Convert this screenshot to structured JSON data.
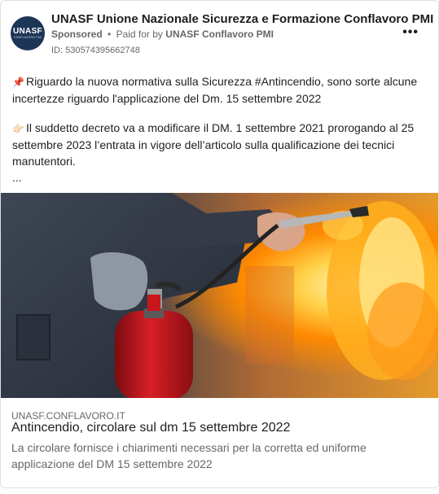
{
  "post": {
    "page_name": "UNASF Unione Nazionale Sicurezza e Formazione Conflavoro PMI",
    "sponsored_label": "Sponsored",
    "dot": "•",
    "paid_for_prefix": "Paid for by",
    "paid_for_by": "UNASF Conflavoro PMI",
    "ad_id": "ID: 530574395662748",
    "more_label": "•••",
    "avatar": {
      "logo_text": "UNASF",
      "logo_sub": "CONFLAVORO PMI"
    },
    "body": {
      "p1_emoji": "📌",
      "p1": "Riguardo la nuova normativa sulla Sicurezza #Antincendio, sono sorte alcune incertezze riguardo l'applicazione del Dm. 15 settembre 2022",
      "p2_emoji": "👉🏻",
      "p2": "Il suddetto decreto va a modificare il DM. 1 settembre 2021 prorogando al 25 settembre 2023 l’entrata in vigore dell’articolo sulla qualificazione dei tecnici manutentori.",
      "ellipsis": "..."
    },
    "link": {
      "domain": "UNASF.CONFLAVORO.IT",
      "title": "Antincendio, circolare sul dm 15 settembre 2022",
      "description": "La circolare fornisce i chiarimenti necessari per la corretta ed uniforme applicazione del DM 15 settembre 2022"
    },
    "colors": {
      "accent_text": "#1c1e21",
      "secondary_text": "#65676b",
      "avatar_bg": "#1d3557",
      "extinguisher_red": "#c8161d",
      "fire_orange": "#ff8a00"
    }
  }
}
